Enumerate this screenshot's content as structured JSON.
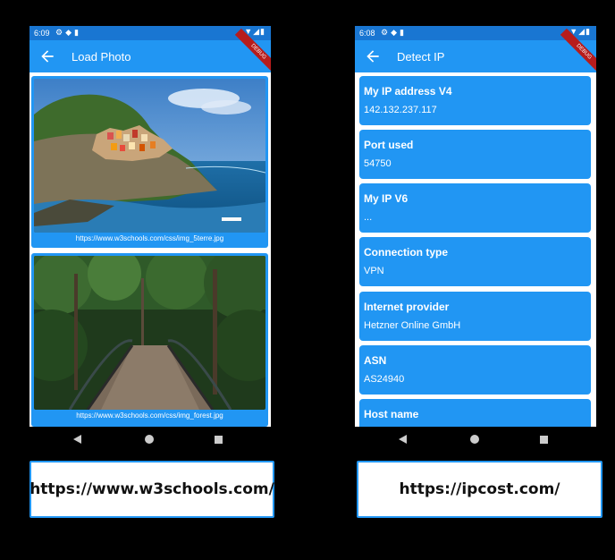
{
  "left_phone": {
    "status_time": "6:09",
    "title": "Load Photo",
    "debug_label": "DEBUG",
    "photos": [
      {
        "caption": "https://www.w3schools.com/css/img_5terre.jpg"
      },
      {
        "caption": "https://www.w3schools.com/css/img_forest.jpg"
      }
    ]
  },
  "right_phone": {
    "status_time": "6:08",
    "title": "Detect IP",
    "debug_label": "DEBUG",
    "cards": [
      {
        "title": "My IP address V4",
        "value": "142.132.237.117"
      },
      {
        "title": "Port used",
        "value": "54750"
      },
      {
        "title": "My IP V6",
        "value": "..."
      },
      {
        "title": "Connection type",
        "value": "VPN"
      },
      {
        "title": "Internet provider",
        "value": "Hetzner Online GmbH"
      },
      {
        "title": "ASN",
        "value": "AS24940"
      },
      {
        "title": "Host name",
        "value": ""
      }
    ]
  },
  "captions": {
    "left_url": "https://www.w3schools.com/",
    "right_url": "https://ipcost.com/"
  },
  "colors": {
    "appbar": "#2196f3",
    "statusbar": "#1976d2",
    "card": "#2196f3"
  }
}
